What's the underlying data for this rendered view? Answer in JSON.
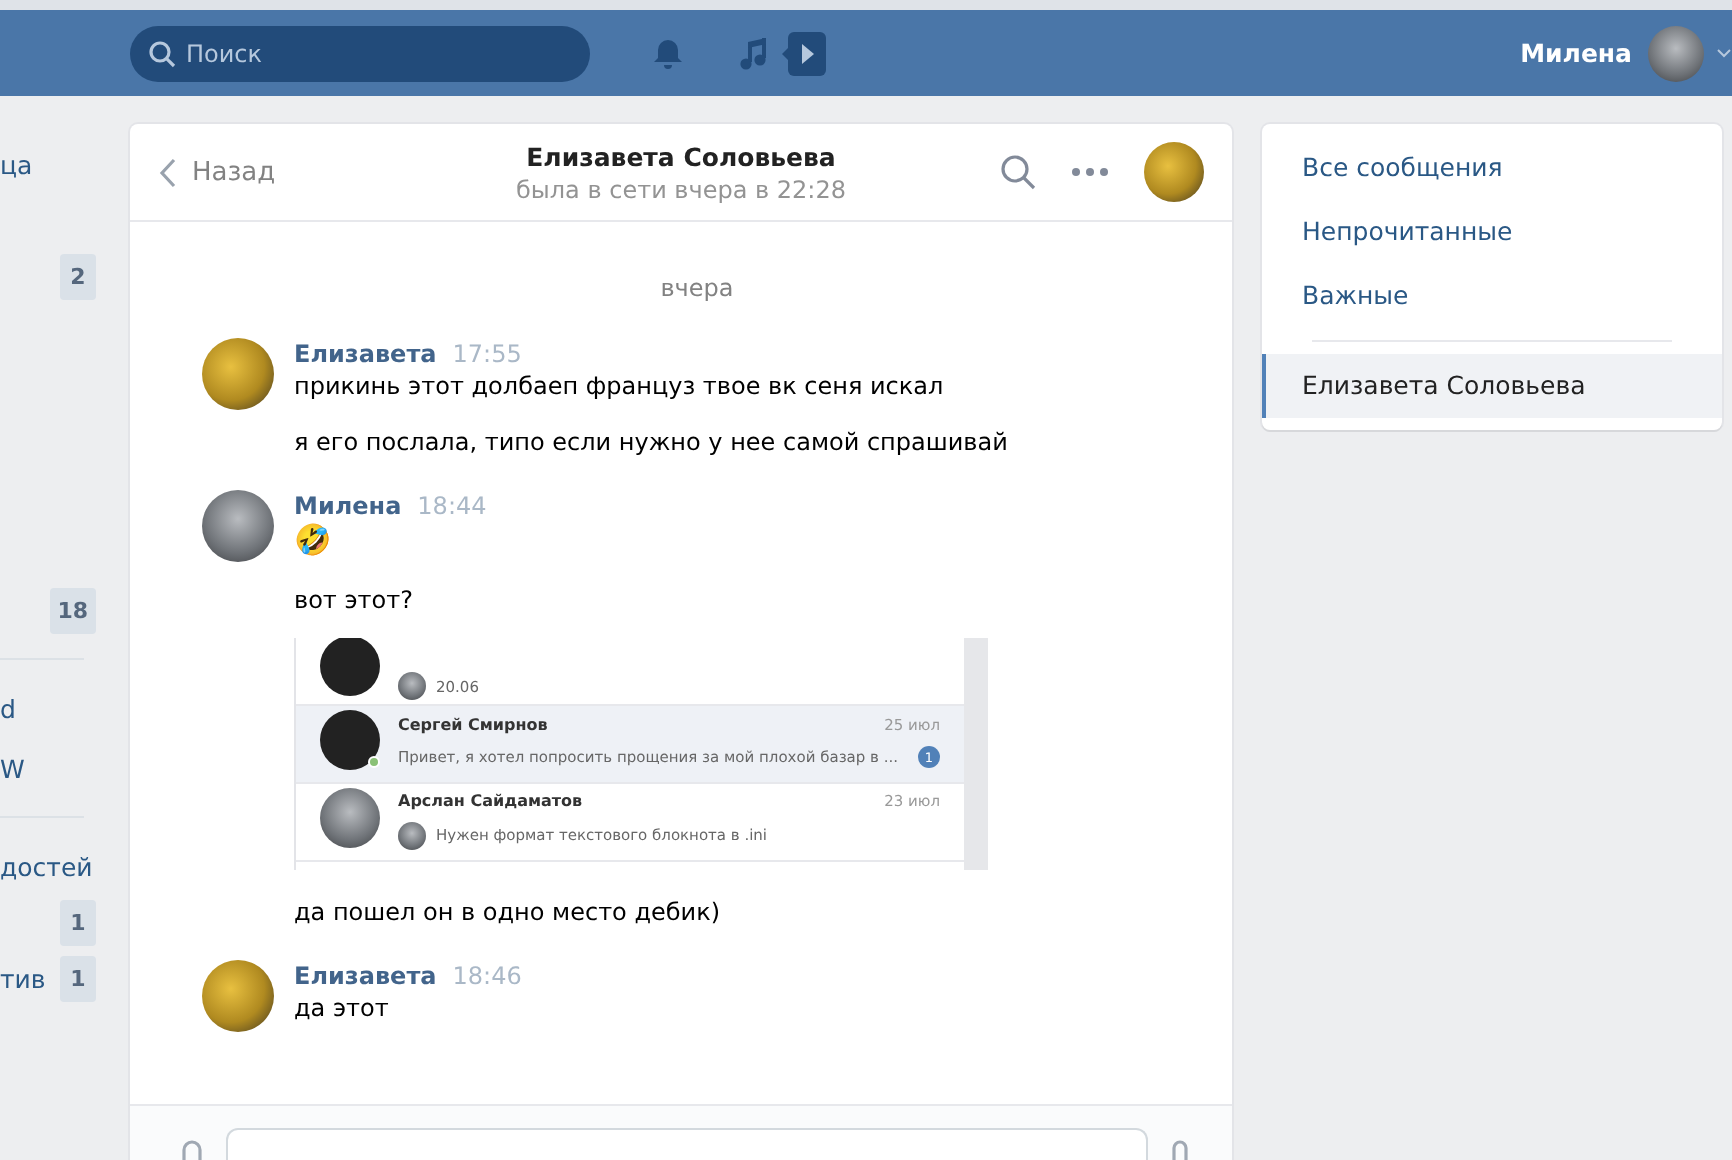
{
  "top_bar": {
    "search": {
      "placeholder": "Поиск"
    },
    "user_name": "Милена"
  },
  "left_menu": [
    {
      "kind": "item",
      "text": "ца"
    },
    {
      "kind": "item",
      "badge": "2"
    },
    {
      "kind": "item",
      "badge": "18"
    },
    {
      "kind": "divider"
    },
    {
      "kind": "item",
      "text": "d"
    },
    {
      "kind": "item",
      "text": "W"
    },
    {
      "kind": "divider"
    },
    {
      "kind": "item",
      "text": "достей"
    },
    {
      "kind": "item",
      "badge": "1"
    },
    {
      "kind": "item",
      "text": "тив",
      "badge": "1"
    }
  ],
  "chat": {
    "back": "Назад",
    "title": "Елизавета Соловьева",
    "status": "была в сети вчера в 22:28",
    "date": "вчера",
    "messages": [
      {
        "author": "Елизавета",
        "time": "17:55",
        "kind": "contact",
        "parts": [
          {
            "kind": "text",
            "text": "прикинь этот долбаеп француз твое вк сеня искал"
          },
          {
            "kind": "text",
            "text": "я его послала, типо если нужно у нее самой спрашивай"
          }
        ]
      },
      {
        "author": "Милена",
        "time": "18:44",
        "kind": "self",
        "parts": [
          {
            "kind": "emoji",
            "text": "🤣"
          },
          {
            "kind": "text",
            "text": "вот этот?"
          },
          {
            "kind": "screenshot"
          },
          {
            "kind": "text",
            "text": "да пошел он в одно место дебик)"
          }
        ]
      },
      {
        "author": "Елизавета",
        "time": "18:46",
        "kind": "contact",
        "parts": [
          {
            "kind": "text",
            "text": "да этот"
          }
        ]
      }
    ],
    "screenshot_rows": [
      {
        "preview": "20.06",
        "selected": false
      },
      {
        "name": "Сергей Смирнов",
        "date": "25 июл",
        "preview": "Привет, я хотел попросить прощения за мой плохой базар в ...",
        "unread_count": "1",
        "selected": true,
        "online": true
      },
      {
        "name": "Арслан Сайдаматов",
        "date": "23 июл",
        "preview": "Нужен формат текстового блокнота в .ini",
        "selected": false,
        "online": false
      }
    ]
  },
  "right_menu": [
    {
      "label": "Все сообщения",
      "selected": false
    },
    {
      "label": "Непрочитанные",
      "selected": false
    },
    {
      "label": "Важные",
      "selected": false
    },
    {
      "kind": "divider"
    },
    {
      "label": "Елизавета Соловьева",
      "selected": true
    }
  ]
}
